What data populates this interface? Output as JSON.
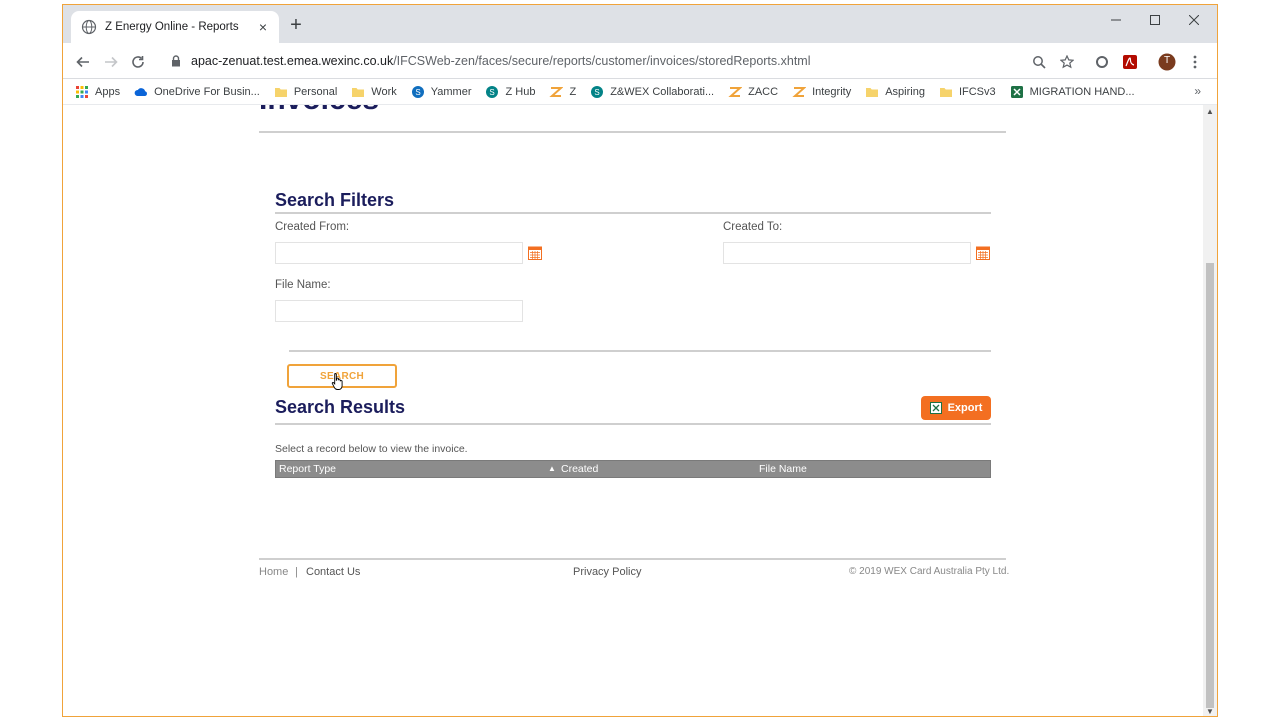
{
  "browser": {
    "tab_title": "Z Energy Online - Reports",
    "tab_close": "×",
    "new_tab": "+",
    "url_host": "apac-zenuat.test.emea.wexinc.co.uk",
    "url_path": "/IFCSWeb-zen/faces/secure/reports/customer/invoices/storedReports.xhtml",
    "profile_initial": "T"
  },
  "bookmarks": [
    {
      "label": "Apps",
      "icon": "apps-grid-icon",
      "color": "#ea4335"
    },
    {
      "label": "OneDrive For Busin...",
      "icon": "cloud-icon",
      "color": "#0a64d8"
    },
    {
      "label": "Personal",
      "icon": "folder-icon",
      "color": "#f6d36b"
    },
    {
      "label": "Work",
      "icon": "folder-icon",
      "color": "#f6d36b"
    },
    {
      "label": "Yammer",
      "icon": "yammer-icon",
      "color": "#106ebe"
    },
    {
      "label": "Z Hub",
      "icon": "sharepoint-icon",
      "color": "#038387"
    },
    {
      "label": "Z",
      "icon": "z-logo-icon",
      "color": "#f0a33a"
    },
    {
      "label": "Z&WEX Collaborati...",
      "icon": "sharepoint-icon",
      "color": "#038387"
    },
    {
      "label": "ZACC",
      "icon": "z-logo-icon",
      "color": "#f0a33a"
    },
    {
      "label": "Integrity",
      "icon": "z-logo-icon",
      "color": "#f0a33a"
    },
    {
      "label": "Aspiring",
      "icon": "folder-icon",
      "color": "#f6d36b"
    },
    {
      "label": "IFCSv3",
      "icon": "folder-icon",
      "color": "#f6d36b"
    },
    {
      "label": "MIGRATION HAND...",
      "icon": "excel-icon",
      "color": "#1e7145"
    }
  ],
  "bookmarks_more": "»",
  "page": {
    "heading": "Invoices",
    "filters_title": "Search Filters",
    "created_from_label": "Created From:",
    "created_to_label": "Created To:",
    "file_name_label": "File Name:",
    "created_from_value": "",
    "created_to_value": "",
    "file_name_value": "",
    "search_button": "SEARCH",
    "results_title": "Search Results",
    "export_button": "Export",
    "results_hint": "Select a record below to view the invoice.",
    "columns": [
      "Report Type",
      "Created",
      "File Name"
    ],
    "sort_indicator": "▲"
  },
  "footer": {
    "home": "Home",
    "separator": "|",
    "contact": "Contact Us",
    "privacy": "Privacy Policy",
    "copyright": "© 2019 WEX Card Australia Pty Ltd."
  },
  "colors": {
    "heading": "#1b1d5c",
    "accent": "#f0a33a",
    "export": "#f36f21",
    "grid_header": "#8c8c8c"
  }
}
